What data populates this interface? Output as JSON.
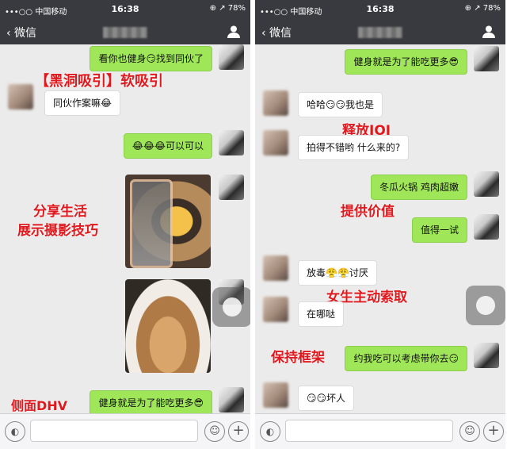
{
  "left": {
    "status": {
      "carrier": "•••○○ 中国移动",
      "time": "16:38",
      "battery": "⊕ ↗ 78%"
    },
    "nav": {
      "back": "‹ 微信"
    },
    "messages": {
      "m1": "看你也健身😏找到同伙了",
      "m2": "同伙作案嘛😂",
      "m3": "😂😂😂可以可以",
      "m4": "健身就是为了能吃更多😎"
    },
    "annotations": {
      "a1": "【黑洞吸引】软吸引",
      "a2": "分享生活",
      "a3": "展示摄影技巧",
      "a4": "侧面DHV"
    }
  },
  "right": {
    "status": {
      "carrier": "•••○○ 中国移动",
      "time": "16:38",
      "battery": "⊕ ↗ 78%"
    },
    "nav": {
      "back": "‹ 微信"
    },
    "messages": {
      "m1": "健身就是为了能吃更多😎",
      "m2": "哈哈😏😏我也是",
      "m3": "拍得不错哟 什么来的?",
      "m4": "冬瓜火锅 鸡肉超嫩",
      "m5": "值得一试",
      "m6": "放毒😤😤讨厌",
      "m7": "在哪哒",
      "m8": "约我吃可以考虑带你去😏",
      "m9": "😏😏坏人"
    },
    "annotations": {
      "a1": "释放IOI",
      "a2": "提供价值",
      "a3": "女生主动索取",
      "a4": "保持框架"
    }
  },
  "icons": {
    "voice": "voice-icon",
    "emoji": "emoji-icon",
    "plus": "plus-icon",
    "person": "person-icon"
  },
  "colors": {
    "header": "#393a3f",
    "chat_bg": "#ebebeb",
    "green_bubble": "#9fe658",
    "annotation": "#e0191e"
  }
}
